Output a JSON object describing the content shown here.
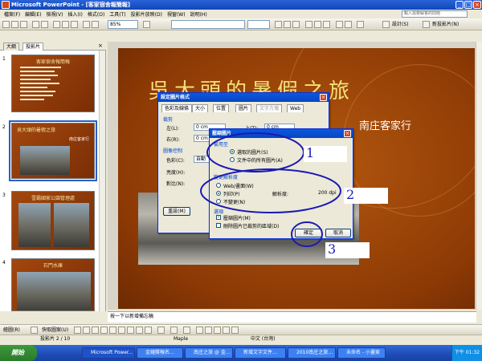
{
  "window": {
    "title": "Microsoft PowerPoint - [客家宿舍報簡報]",
    "min": "_",
    "max": "□",
    "close": "×"
  },
  "menu": [
    "檔案(F)",
    "編輯(E)",
    "檢視(V)",
    "插入(I)",
    "格式(O)",
    "工具(T)",
    "投影片放映(D)",
    "視窗(W)",
    "說明(H)"
  ],
  "help_search": {
    "placeholder": "輸入需要解答的問題"
  },
  "toolbar": {
    "zoom": "85%",
    "font": "",
    "size": "",
    "design_label": "設計(S)",
    "new_slide_label": "新投影片(N)"
  },
  "pane_tabs": {
    "outline": "大綱",
    "slides": "投影片"
  },
  "thumbnails": [
    {
      "num": "1",
      "title": "客家宿舍報簡報"
    },
    {
      "num": "2",
      "title": "吳大頭的暑假之旅",
      "sub": "南庄客家行"
    },
    {
      "num": "3",
      "title": "雪霸國家公園管理處"
    },
    {
      "num": "4",
      "title": "石門水庫"
    }
  ],
  "slide": {
    "title": "吳大頭的暑假之旅",
    "subtitle": "南庄客家行"
  },
  "notes": {
    "text": "按一下以新增備忘稿"
  },
  "format_dialog": {
    "title": "設定圖片格式",
    "tabs": [
      "色彩及線條",
      "大小",
      "位置",
      "圖片",
      "文字方塊",
      "Web"
    ],
    "crop_group": "裁剪",
    "left_label": "左(L):",
    "left_value": "0 cm",
    "right_label": "右(R):",
    "right_value": "0 cm",
    "top_label": "上(T):",
    "top_value": "0 cm",
    "image_group": "圖像控制",
    "color_label": "色彩(C):",
    "color_value": "自動",
    "brightness_label": "亮度(H):",
    "contrast_label": "對比(N):",
    "reset_label": "重設(M)"
  },
  "compress_dialog": {
    "title": "壓縮圖片",
    "apply_group": "套用至",
    "apply_selected": "選取的圖片(S)",
    "apply_all": "文件中的所有圖片(A)",
    "resolution_group": "變更解析度",
    "res_web": "Web/畫面(W)",
    "res_print": "列印(P)",
    "res_none": "不變更(N)",
    "resolution_label": "解析度:",
    "resolution_value": "200 dpi",
    "options_group": "選項",
    "compress_check": "壓縮圖片(M)",
    "delete_crop_check": "刪除圖片已裁剪的區域(D)",
    "ok": "確定",
    "cancel": "取消"
  },
  "annotations": [
    "1",
    "2",
    "3"
  ],
  "drawbar": {
    "draw": "繪圖(R)",
    "autoshapes": "快取圖案(U)"
  },
  "status": {
    "slide": "投影片 2 / 10",
    "theme": "Maple",
    "lang": "中文 (台灣)"
  },
  "taskbar": {
    "start": "開始",
    "tasks": [
      "Microsoft Power...",
      "金鐘獎報名…",
      "南庄之旅 @ 金…",
      "新增文字文件…",
      "2010南庄之旅…",
      "未命名 - 小畫家"
    ],
    "clock": "下午 01:32"
  }
}
